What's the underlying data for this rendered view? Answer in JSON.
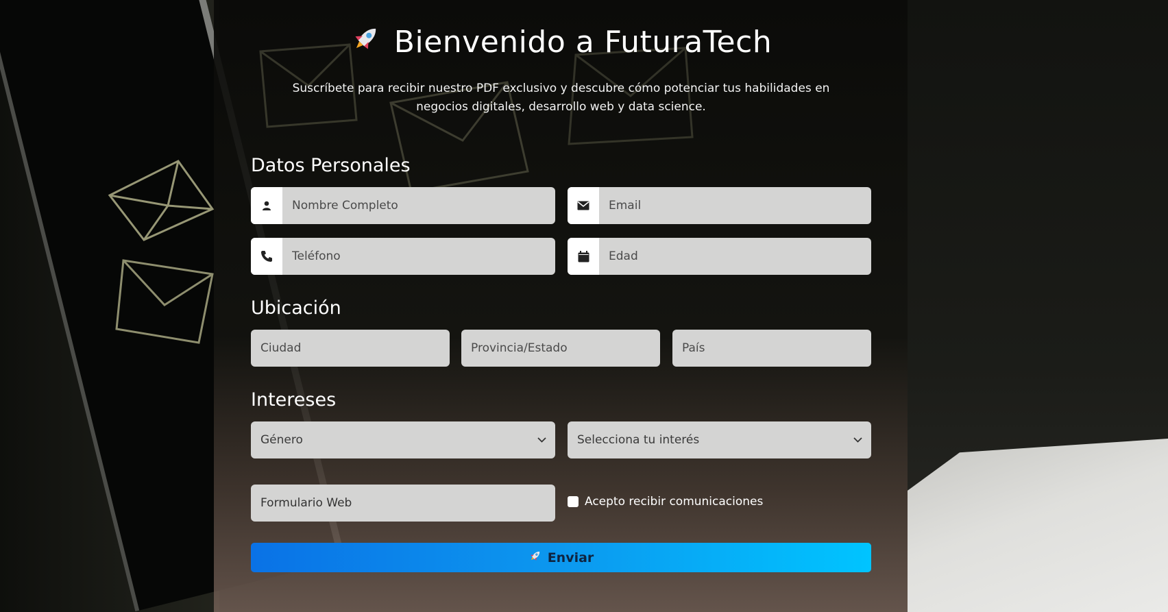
{
  "header": {
    "title": "Bienvenido a FuturaTech",
    "subtitle": "Suscríbete para recibir nuestro PDF exclusivo y descubre cómo potenciar tus habilidades en negocios digitales, desarrollo web y data science."
  },
  "sections": {
    "personal": "Datos Personales",
    "location": "Ubicación",
    "interests": "Intereses"
  },
  "fields": {
    "name_placeholder": "Nombre Completo",
    "email_placeholder": "Email",
    "phone_placeholder": "Teléfono",
    "age_placeholder": "Edad",
    "city_placeholder": "Ciudad",
    "province_placeholder": "Provincia/Estado",
    "country_placeholder": "País",
    "source_value": "Formulario Web"
  },
  "selects": {
    "gender": "Género",
    "interest": "Selecciona tu interés"
  },
  "consent_label": "Acepto recibir comunicaciones",
  "submit_label": "Enviar",
  "icons": {
    "name": "user-icon",
    "email": "envelope-icon",
    "phone": "phone-icon",
    "age": "calendar-icon",
    "title": "rocket-icon"
  },
  "colors": {
    "button_start": "#0a72e6",
    "button_end": "#00c4ff",
    "field_bg": "#d4d4d3"
  }
}
